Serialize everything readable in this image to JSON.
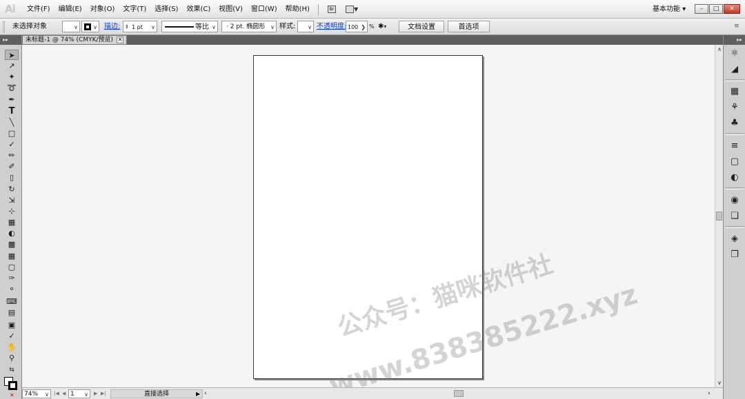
{
  "app": {
    "logo": "Ai"
  },
  "menubar": {
    "items": [
      "文件(F)",
      "编辑(E)",
      "对象(O)",
      "文字(T)",
      "选择(S)",
      "效果(C)",
      "视图(V)",
      "窗口(W)",
      "帮助(H)"
    ],
    "bridge_label": "Br",
    "workspace": "基本功能 ▾"
  },
  "control": {
    "selection_status": "未选择对象",
    "stroke_label": "描边:",
    "stroke_weight": "1 pt",
    "profile": "等比",
    "brush": "2 pt. 椭圆形",
    "style_label": "样式:",
    "opacity_label": "不透明度:",
    "opacity_value": "100",
    "opacity_unit": "%",
    "doc_setup": "文档设置",
    "preferences": "首选项"
  },
  "document": {
    "tab_title": "未标题-1 @ 74% (CMYK/预览)"
  },
  "status": {
    "zoom": "74%",
    "artboard_number": "1",
    "current_tool": "直接选择"
  },
  "watermark": {
    "line1": "公众号：猫咪软件社",
    "line2": "www.838385222.xyz"
  },
  "colors": {
    "menubar": "#ebebeb",
    "panel": "#cfcfcf",
    "dark_strip": "#5f5f5f",
    "canvas": "#f5f5f5",
    "link": "#0b3fc5"
  }
}
